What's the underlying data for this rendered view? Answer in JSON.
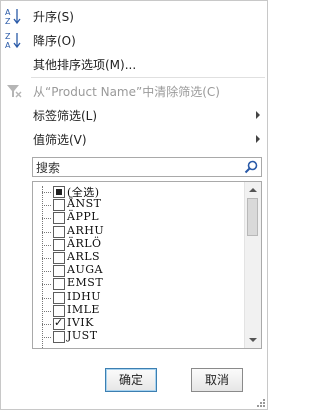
{
  "menu": {
    "sort_asc": "升序(S)",
    "sort_desc": "降序(O)",
    "more_sort": "其他排序选项(M)...",
    "clear_filter": "从“Product Name”中清除筛选(C)",
    "label_filter": "标签筛选(L)",
    "value_filter": "值筛选(V)"
  },
  "search": {
    "placeholder": "搜索"
  },
  "list": {
    "items": [
      {
        "label": "(全选)",
        "state": "partial"
      },
      {
        "label": "ÅNST",
        "state": "unchecked"
      },
      {
        "label": "ÄPPL",
        "state": "unchecked"
      },
      {
        "label": "ARHU",
        "state": "unchecked"
      },
      {
        "label": "ÄRLÖ",
        "state": "unchecked"
      },
      {
        "label": "ARLS",
        "state": "unchecked"
      },
      {
        "label": "AUGA",
        "state": "unchecked"
      },
      {
        "label": "EMST",
        "state": "unchecked"
      },
      {
        "label": "IDHU",
        "state": "unchecked"
      },
      {
        "label": "IMLE",
        "state": "unchecked"
      },
      {
        "label": "IVIK",
        "state": "checked"
      },
      {
        "label": "JUST",
        "state": "unchecked"
      }
    ]
  },
  "buttons": {
    "ok": "确定",
    "cancel": "取消"
  }
}
